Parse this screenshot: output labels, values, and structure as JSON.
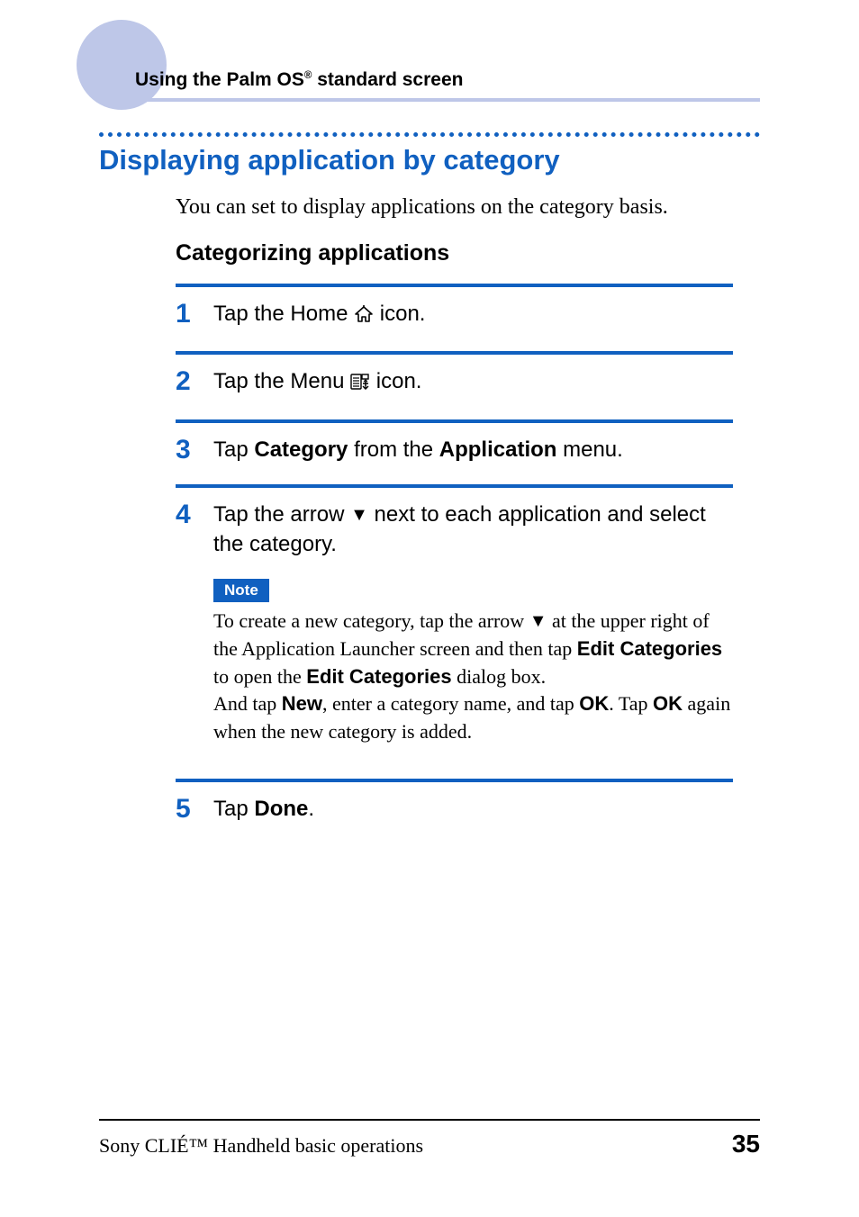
{
  "header": {
    "prefix": "Using the Palm OS",
    "reg": "®",
    "suffix": " standard screen"
  },
  "section_title": "Displaying application by category",
  "intro": "You can set to display applications on the category basis.",
  "sub_heading": "Categorizing applications",
  "steps": {
    "s1": {
      "num": "1",
      "pre": "Tap the Home ",
      "post": " icon."
    },
    "s2": {
      "num": "2",
      "pre": "Tap the Menu ",
      "post": " icon."
    },
    "s3": {
      "num": "3",
      "line_pre": "Tap ",
      "b1": "Category",
      "mid": " from the ",
      "b2": "Application",
      "post": " menu."
    },
    "s4": {
      "num": "4",
      "line_pre": "Tap the arrow ",
      "line_post": " next to each application and select the category.",
      "note_label": "Note",
      "note_a": "To create a new category, tap the arrow ",
      "note_b": " at the upper right of the Application Launcher screen and then tap ",
      "b_edit1": "Edit Categories",
      "note_c": " to open the ",
      "b_edit2": "Edit Categories",
      "note_d": " dialog box.",
      "note_e_pre": "And tap ",
      "b_new": "New",
      "note_e_mid": ", enter a category name, and tap ",
      "b_ok1": "OK",
      "note_e_mid2": ". Tap ",
      "b_ok2": "OK",
      "note_e_post": " again when the new category is added."
    },
    "s5": {
      "num": "5",
      "pre": "Tap ",
      "b": "Done",
      "post": "."
    }
  },
  "footer": {
    "left": "Sony CLIÉ™ Handheld basic operations",
    "page": "35"
  },
  "icons": {
    "triangle": "▼"
  }
}
